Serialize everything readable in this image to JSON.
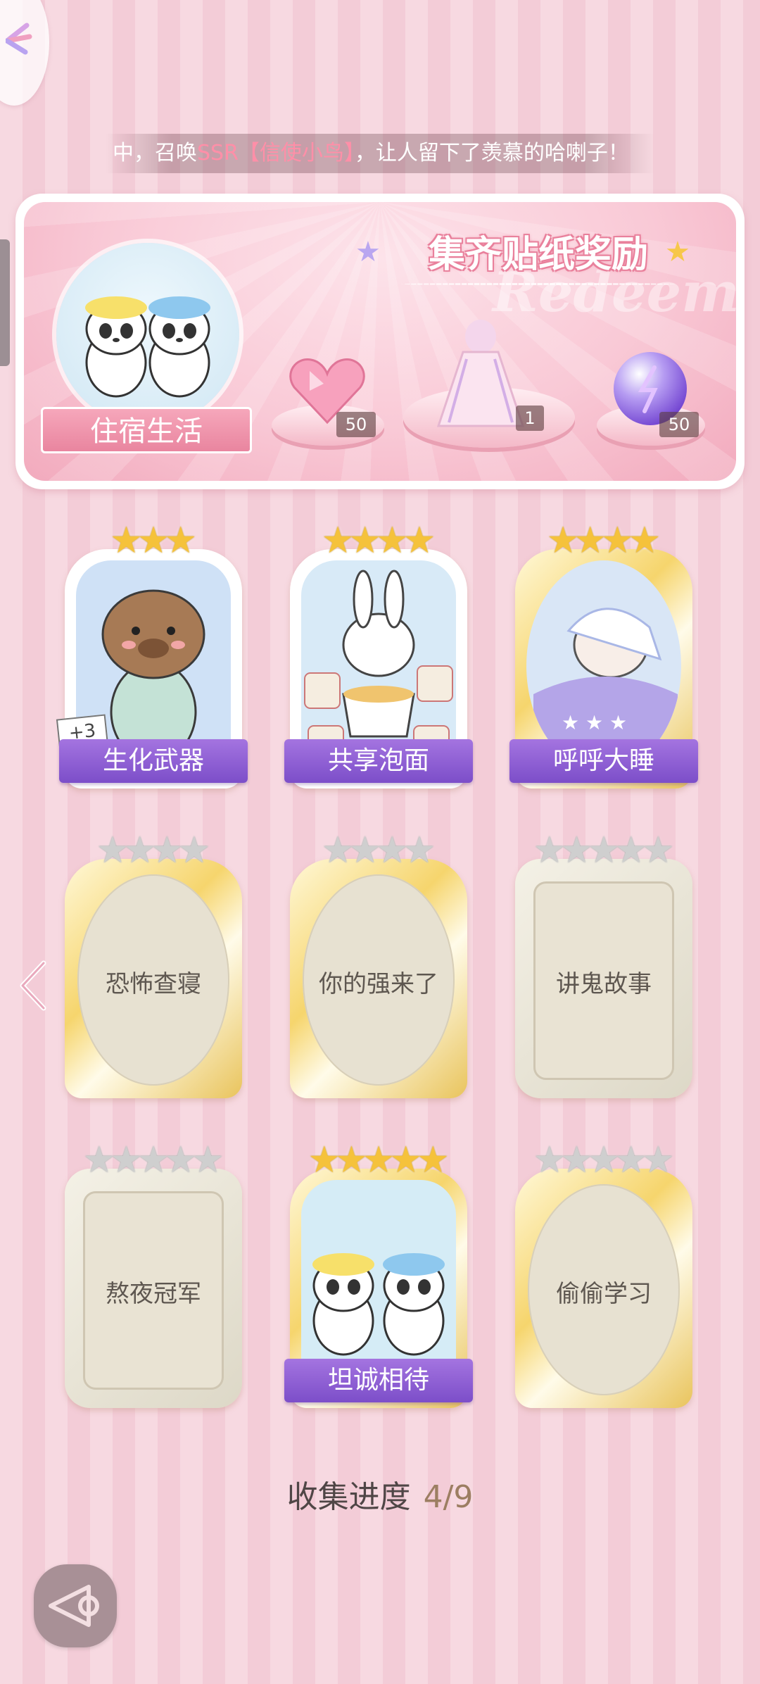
{
  "marquee": {
    "prefix": "中，召唤",
    "highlight": "SSR【信使小鸟】",
    "suffix": "，让人留下了羡慕的哈喇子！"
  },
  "banner": {
    "title": "集齐贴纸奖励",
    "watermark": "Redeem",
    "theme_label": "住宿生活",
    "rewards": [
      {
        "name": "pink-heart-gem",
        "count": "50"
      },
      {
        "name": "outfit",
        "count": "1"
      },
      {
        "name": "purple-orb",
        "count": "50"
      }
    ]
  },
  "cards": [
    {
      "name": "生化武器",
      "stars": 3,
      "unlocked": true,
      "badge": "+3"
    },
    {
      "name": "共享泡面",
      "stars": 4,
      "unlocked": true
    },
    {
      "name": "呼呼大睡",
      "stars": 4,
      "unlocked": true
    },
    {
      "name": "恐怖查寝",
      "stars": 4,
      "unlocked": false
    },
    {
      "name": "你的强来了",
      "stars": 4,
      "unlocked": false
    },
    {
      "name": "讲鬼故事",
      "stars": 5,
      "unlocked": false
    },
    {
      "name": "熬夜冠军",
      "stars": 5,
      "unlocked": false
    },
    {
      "name": "坦诚相待",
      "stars": 5,
      "unlocked": true
    },
    {
      "name": "偷偷学习",
      "stars": 5,
      "unlocked": false
    }
  ],
  "progress": {
    "label": "收集进度",
    "value": "4/9"
  },
  "colors": {
    "accent_purple": "#8a5bd1",
    "gold": "#f5c23b",
    "pink": "#f3ccd7"
  },
  "icons": {
    "top_left": "fan-icon",
    "prev": "chevron-left-icon",
    "back": "back-arrow-icon"
  }
}
